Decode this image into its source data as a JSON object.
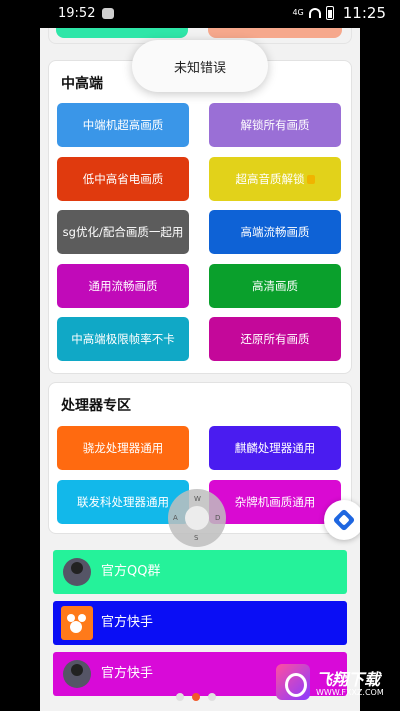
{
  "status_bar": {
    "time_left": "19:52",
    "signal_text": "4G",
    "time_right": "11:25"
  },
  "toast": "未知错误",
  "mid_high": {
    "title": "中高端",
    "buttons": [
      {
        "label": "中端机超高画质",
        "color": "#3a96e8"
      },
      {
        "label": "解锁所有画质",
        "color": "#9a6fd6"
      },
      {
        "label": "低中高省电画质",
        "color": "#e03a0e"
      },
      {
        "label": "超高音质解锁",
        "color": "#e2d21a"
      },
      {
        "label": "sg优化/配合画质一起用",
        "color": "#5c5c5c"
      },
      {
        "label": "高端流畅画质",
        "color": "#0e62d6"
      },
      {
        "label": "通用流畅画质",
        "color": "#c10ab9"
      },
      {
        "label": "高清画质",
        "color": "#0aa02c"
      },
      {
        "label": "中高端极限帧率不卡",
        "color": "#10a8c6"
      },
      {
        "label": "还原所有画质",
        "color": "#c4089a"
      }
    ]
  },
  "processor": {
    "title": "处理器专区",
    "buttons": [
      {
        "label": "骁龙处理器通用",
        "color": "#ff6a10"
      },
      {
        "label": "麒麟处理器通用",
        "color": "#4a1cf0"
      },
      {
        "label": "联发科处理器通用",
        "color": "#12b8ea"
      },
      {
        "label": "杂牌机画质通用",
        "color": "#d90ad2"
      }
    ]
  },
  "assist_keys": {
    "w": "W",
    "a": "A",
    "s": "S",
    "d": "D"
  },
  "links": [
    {
      "label": "官方QQ群",
      "color": "#25f29a",
      "icon": "avatar-icon"
    },
    {
      "label": "官方快手",
      "color": "#0a0ef5",
      "icon": "kuaishou-icon"
    },
    {
      "label": "官方快手",
      "color": "#d80ad8",
      "icon": "avatar-icon"
    }
  ],
  "watermark": {
    "name": "飞翔下载",
    "url": "WWW.FXXZ.COM"
  }
}
